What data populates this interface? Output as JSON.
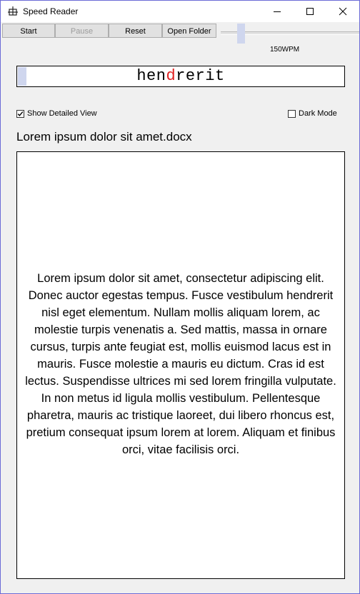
{
  "window": {
    "title": "Speed Reader"
  },
  "toolbar": {
    "start_label": "Start",
    "pause_label": "Pause",
    "reset_label": "Reset",
    "open_folder_label": "Open Folder",
    "wpm_label": "150WPM"
  },
  "reader": {
    "word_before": "hen",
    "word_focus": "d",
    "word_after": "rerit",
    "focus_color": "#e02020"
  },
  "options": {
    "detailed_view_label": "Show Detailed View",
    "detailed_view_checked": true,
    "dark_mode_label": "Dark Mode",
    "dark_mode_checked": false
  },
  "document": {
    "filename": "Lorem ipsum dolor sit amet.docx",
    "text": "Lorem ipsum dolor sit amet, consectetur adipiscing elit. Donec auctor egestas tempus. Fusce vestibulum hendrerit nisl eget elementum. Nullam mollis aliquam lorem, ac molestie turpis venenatis a. Sed mattis, massa in ornare cursus, turpis ante feugiat est, mollis euismod lacus est in mauris. Fusce molestie a mauris eu dictum. Cras id est lectus. Suspendisse ultrices mi sed lorem fringilla vulputate. In non metus id ligula mollis vestibulum. Pellentesque pharetra, mauris ac tristique laoreet, dui libero rhoncus est, pretium consequat ipsum lorem at lorem. Aliquam et finibus orci, vitae facilisis orci."
  }
}
